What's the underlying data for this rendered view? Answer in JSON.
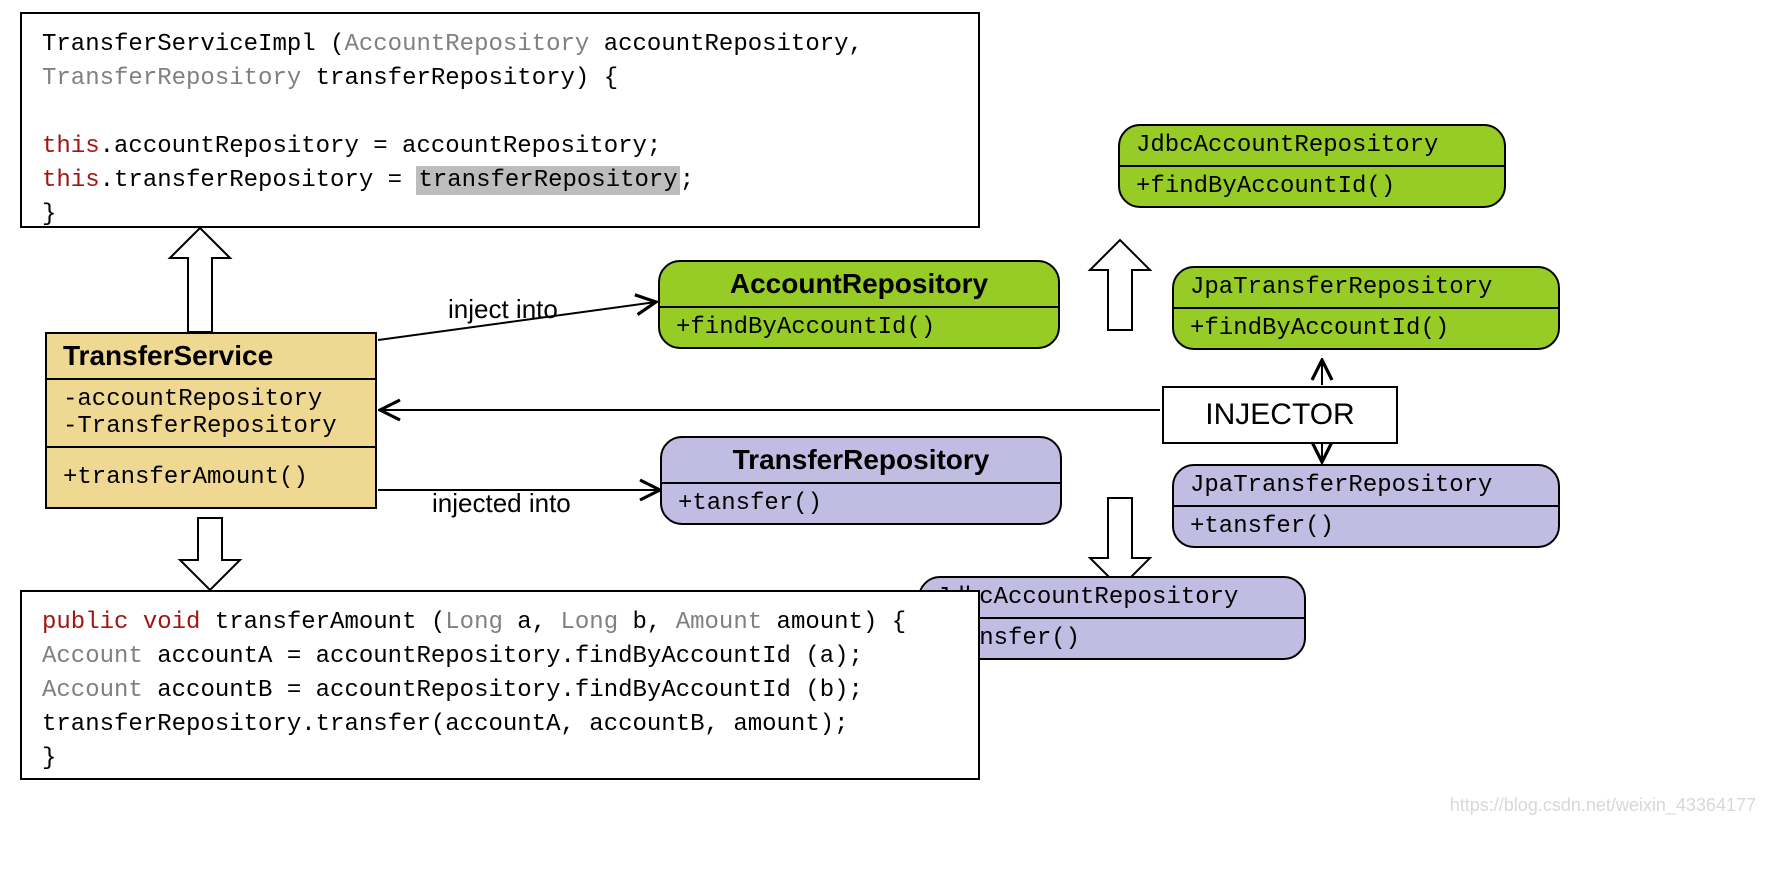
{
  "codeTop": {
    "lines": [
      [
        {
          "t": "TransferServiceImpl ("
        },
        {
          "t": "AccountRepository",
          "cls": "pm"
        },
        {
          "t": " accountRepository, "
        }
      ],
      [
        {
          "t": "TransferRepository",
          "cls": "pm"
        },
        {
          "t": " transferRepository) {"
        }
      ],
      [
        {
          "t": ""
        }
      ],
      [
        {
          "t": "this",
          "cls": "kw"
        },
        {
          "t": ".accountRepository = accountRepository;"
        }
      ],
      [
        {
          "t": "this",
          "cls": "kw"
        },
        {
          "t": ".transferRepository = "
        },
        {
          "t": "transferRepository",
          "cls": "sel"
        },
        {
          "t": ";"
        }
      ],
      [
        {
          "t": "}"
        }
      ]
    ]
  },
  "codeBottom": {
    "lines": [
      [
        {
          "t": "public void",
          "cls": "kw"
        },
        {
          "t": " transferAmount ("
        },
        {
          "t": "Long",
          "cls": "pm"
        },
        {
          "t": " a, "
        },
        {
          "t": "Long",
          "cls": "pm"
        },
        {
          "t": " b, "
        },
        {
          "t": "Amount",
          "cls": "pm"
        },
        {
          "t": " amount) {"
        }
      ],
      [
        {
          "t": "Account",
          "cls": "pm"
        },
        {
          "t": " accountA = accountRepository.findByAccountId (a);"
        }
      ],
      [
        {
          "t": "Account",
          "cls": "pm"
        },
        {
          "t": " accountB = accountRepository.findByAccountId (b);"
        }
      ],
      [
        {
          "t": "transferRepository.transfer(accountA, accountB, amount);"
        }
      ],
      [
        {
          "t": "}"
        }
      ]
    ]
  },
  "transferService": {
    "title": "TransferService",
    "fields": [
      "-accountRepository",
      "-TransferRepository"
    ],
    "methods": [
      "+transferAmount()"
    ]
  },
  "accountRepo": {
    "title": "AccountRepository",
    "methods": [
      "+findByAccountId()"
    ]
  },
  "transferRepo": {
    "title": "TransferRepository",
    "methods": [
      "+tansfer()"
    ]
  },
  "jdbcAccount": {
    "title": "JdbcAccountRepository",
    "methods": [
      "+findByAccountId()"
    ]
  },
  "jpaTransfer": {
    "title": "JpaTransferRepository",
    "methods": [
      "+findByAccountId()"
    ]
  },
  "jpaTransfer2": {
    "title": "JpaTransferRepository",
    "methods": [
      "+tansfer()"
    ]
  },
  "jdbcAccount2": {
    "title": "JdbcAccountRepository",
    "methods": [
      "+tansfer()"
    ]
  },
  "injector": "INJECTOR",
  "labels": {
    "inject": "inject into",
    "injected": "injected into"
  },
  "watermark": "https://blog.csdn.net/weixin_43364177"
}
